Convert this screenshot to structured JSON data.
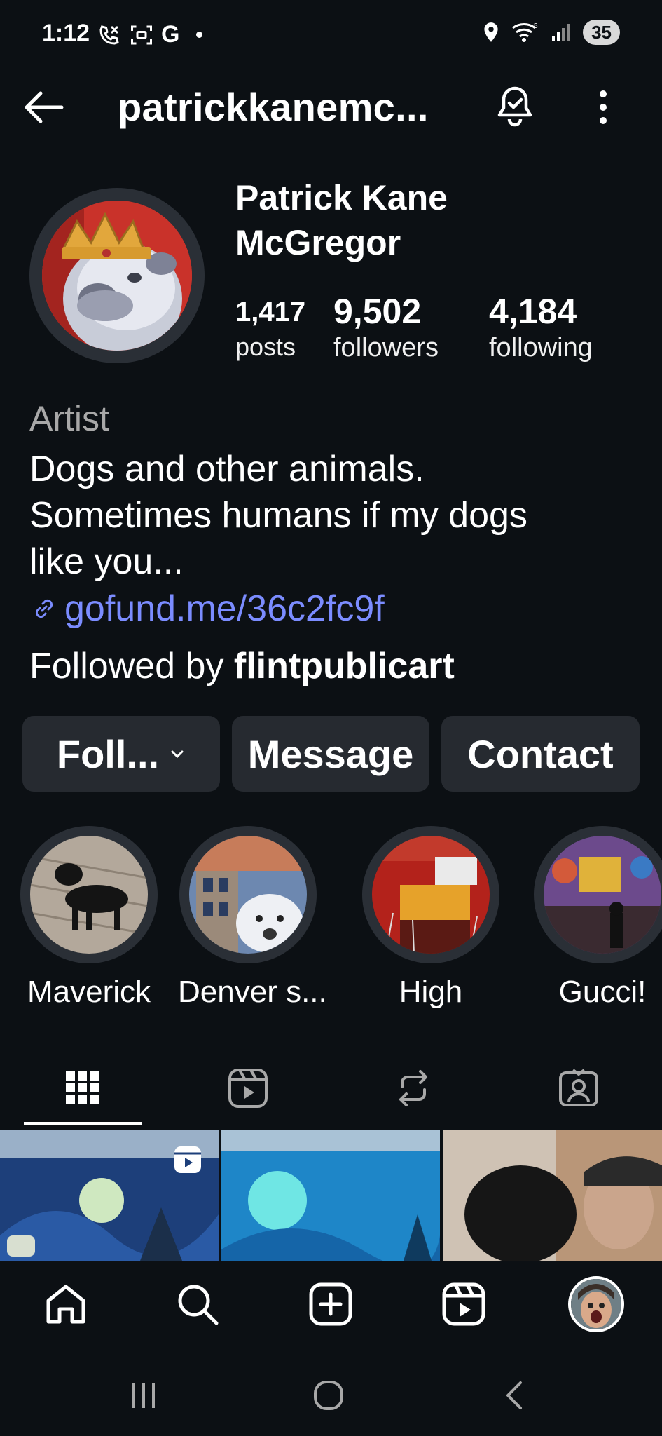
{
  "status_bar": {
    "time": "1:12",
    "carrier_letter": "G",
    "battery": "35"
  },
  "header": {
    "username": "patrickkanemc..."
  },
  "profile": {
    "full_name_line1": "Patrick Kane",
    "full_name_line2": "McGregor",
    "stats": {
      "posts_count": "1,417",
      "posts_label": "posts",
      "followers_count": "9,502",
      "followers_label": "followers",
      "following_count": "4,184",
      "following_label": "following"
    },
    "category": "Artist",
    "bio_line1": "Dogs and other animals.",
    "bio_line2": "Sometimes humans if my dogs",
    "bio_line3": "like you...",
    "link": "gofund.me/36c2fc9f",
    "followed_by_prefix": "Followed by ",
    "followed_by_user": "flintpublicart"
  },
  "actions": {
    "follow": "Foll...",
    "message": "Message",
    "contact": "Contact"
  },
  "highlights": [
    {
      "label": "Maverick"
    },
    {
      "label": "Denver s..."
    },
    {
      "label": "High"
    },
    {
      "label": "Gucci!"
    }
  ],
  "tabs": [
    "grid-icon",
    "reels-icon",
    "reposts-icon",
    "tagged-icon"
  ],
  "bottom_nav": [
    "home-icon",
    "search-icon",
    "create-icon",
    "reels-icon",
    "profile-avatar"
  ],
  "colors": {
    "background": "#0c1014",
    "button": "#262a30",
    "link": "#7b8cff",
    "muted": "#a8a8a8"
  }
}
